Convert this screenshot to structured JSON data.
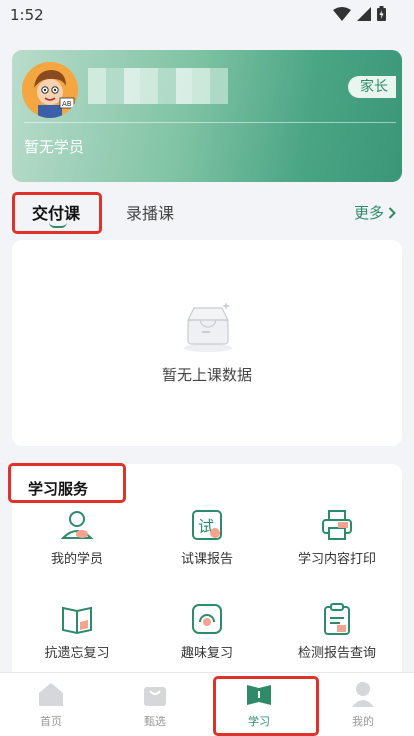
{
  "status_bar": {
    "time": "1:52"
  },
  "profile": {
    "role_badge": "家长",
    "student_status": "暂无学员"
  },
  "tabs": {
    "active": "交付课",
    "inactive": "录播课",
    "more": "更多"
  },
  "empty_state": {
    "text": "暂无上课数据"
  },
  "services": {
    "title": "学习服务",
    "items": [
      {
        "label": "我的学员",
        "icon": "student-icon"
      },
      {
        "label": "试课报告",
        "icon": "trial-report-icon"
      },
      {
        "label": "学习内容打印",
        "icon": "printer-icon"
      },
      {
        "label": "抗遗忘复习",
        "icon": "book-icon"
      },
      {
        "label": "趣味复习",
        "icon": "fun-review-icon"
      },
      {
        "label": "检测报告查询",
        "icon": "clipboard-icon"
      }
    ]
  },
  "bottom_nav": {
    "items": [
      {
        "label": "首页",
        "icon": "home-icon"
      },
      {
        "label": "甄选",
        "icon": "shopping-bag-icon"
      },
      {
        "label": "学习",
        "icon": "study-book-icon"
      },
      {
        "label": "我的",
        "icon": "profile-icon"
      }
    ],
    "active_index": 2
  },
  "colors": {
    "accent": "#2f8a6a",
    "highlight": "#e0322a"
  }
}
